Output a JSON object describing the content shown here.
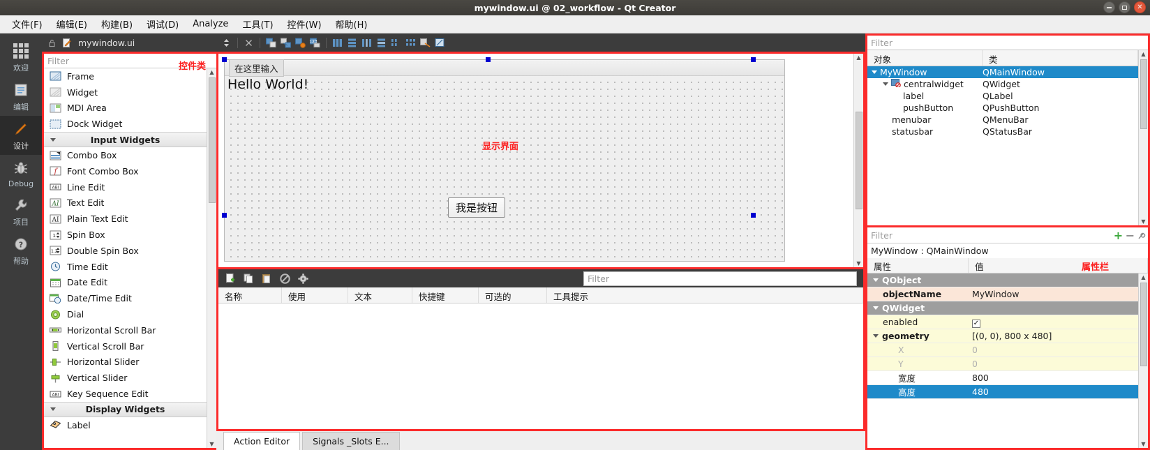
{
  "window": {
    "title": "mywindow.ui @ 02_workflow - Qt Creator",
    "controls": {
      "minimize": "minimize-icon",
      "maximize": "maximize-icon",
      "close": "close-icon"
    }
  },
  "menubar": {
    "items": [
      {
        "label": "文件(F)",
        "mnemonic": "F"
      },
      {
        "label": "编辑(E)",
        "mnemonic": "E"
      },
      {
        "label": "构建(B)",
        "mnemonic": "B"
      },
      {
        "label": "调试(D)",
        "mnemonic": "D"
      },
      {
        "label": "Analyze",
        "mnemonic": "A"
      },
      {
        "label": "工具(T)",
        "mnemonic": "T"
      },
      {
        "label": "控件(W)",
        "mnemonic": "W"
      },
      {
        "label": "帮助(H)",
        "mnemonic": "H"
      }
    ]
  },
  "modebar": {
    "items": [
      {
        "label": "欢迎",
        "icon": "grid-icon",
        "active": false
      },
      {
        "label": "编辑",
        "icon": "document-icon",
        "active": false
      },
      {
        "label": "设计",
        "icon": "pencil-icon",
        "active": true
      },
      {
        "label": "Debug",
        "icon": "bug-icon",
        "active": false
      },
      {
        "label": "项目",
        "icon": "wrench-icon",
        "active": false
      },
      {
        "label": "帮助",
        "icon": "question-icon",
        "active": false
      }
    ]
  },
  "designer_toolbar": {
    "document_name": "mywindow.ui",
    "lock_icon": "lock-icon",
    "file_icon": "file-edit-icon",
    "split_icon": "split-icon",
    "close_icon": "close-document-icon",
    "tools": [
      "edit-widgets-icon",
      "edit-signals-slots-icon",
      "edit-buddies-icon",
      "edit-tab-order-icon",
      "layout-horizontal-icon",
      "layout-vertical-icon",
      "layout-splitter-horizontal-icon",
      "layout-splitter-vertical-icon",
      "layout-form-icon",
      "layout-grid-icon",
      "break-layout-icon",
      "adjust-size-icon"
    ]
  },
  "widget_box": {
    "filter_placeholder": "Filter",
    "annotation": "控件类",
    "groups": [
      {
        "name": "",
        "items": [
          {
            "label": "Frame",
            "icon": "frame-icon"
          },
          {
            "label": "Widget",
            "icon": "widget-icon"
          },
          {
            "label": "MDI Area",
            "icon": "mdi-area-icon"
          },
          {
            "label": "Dock Widget",
            "icon": "dock-widget-icon"
          }
        ]
      },
      {
        "name": "Input Widgets",
        "items": [
          {
            "label": "Combo Box",
            "icon": "combo-box-icon"
          },
          {
            "label": "Font Combo Box",
            "icon": "font-combo-box-icon"
          },
          {
            "label": "Line Edit",
            "icon": "line-edit-icon"
          },
          {
            "label": "Text Edit",
            "icon": "text-edit-icon"
          },
          {
            "label": "Plain Text Edit",
            "icon": "plain-text-edit-icon"
          },
          {
            "label": "Spin Box",
            "icon": "spin-box-icon"
          },
          {
            "label": "Double Spin Box",
            "icon": "double-spin-box-icon"
          },
          {
            "label": "Time Edit",
            "icon": "time-edit-icon"
          },
          {
            "label": "Date Edit",
            "icon": "date-edit-icon"
          },
          {
            "label": "Date/Time Edit",
            "icon": "date-time-edit-icon"
          },
          {
            "label": "Dial",
            "icon": "dial-icon"
          },
          {
            "label": "Horizontal Scroll Bar",
            "icon": "horizontal-scroll-bar-icon"
          },
          {
            "label": "Vertical Scroll Bar",
            "icon": "vertical-scroll-bar-icon"
          },
          {
            "label": "Horizontal Slider",
            "icon": "horizontal-slider-icon"
          },
          {
            "label": "Vertical Slider",
            "icon": "vertical-slider-icon"
          },
          {
            "label": "Key Sequence Edit",
            "icon": "key-sequence-edit-icon"
          }
        ]
      },
      {
        "name": "Display Widgets",
        "items": [
          {
            "label": "Label",
            "icon": "label-icon"
          }
        ]
      }
    ]
  },
  "form_editor": {
    "menubar_placeholder": "在这里输入",
    "label_text": "Hello World!",
    "button_text": "我是按钮",
    "annotation": "显示界面"
  },
  "action_editor": {
    "filter_placeholder": "Filter",
    "toolbar": [
      "new-action-icon",
      "copy-icon",
      "paste-icon",
      "delete-icon",
      "settings-icon"
    ],
    "columns": [
      "名称",
      "使用",
      "文本",
      "快捷键",
      "可选的",
      "工具提示"
    ],
    "rows": [],
    "tabs": [
      {
        "label": "Action Editor",
        "active": true
      },
      {
        "label": "Signals _Slots E...",
        "active": false
      }
    ]
  },
  "object_inspector": {
    "filter_placeholder": "Filter",
    "columns": [
      "对象",
      "类"
    ],
    "rows": [
      {
        "object": "MyWindow",
        "class": "QMainWindow",
        "indent": 0,
        "expander": "down",
        "selected": true,
        "icon": ""
      },
      {
        "object": "centralwidget",
        "class": "QWidget",
        "indent": 1,
        "expander": "down",
        "selected": false,
        "icon": "no-layout-icon"
      },
      {
        "object": "label",
        "class": "QLabel",
        "indent": 2,
        "expander": "",
        "selected": false,
        "icon": ""
      },
      {
        "object": "pushButton",
        "class": "QPushButton",
        "indent": 2,
        "expander": "",
        "selected": false,
        "icon": ""
      },
      {
        "object": "menubar",
        "class": "QMenuBar",
        "indent": 1,
        "expander": "",
        "selected": false,
        "icon": ""
      },
      {
        "object": "statusbar",
        "class": "QStatusBar",
        "indent": 1,
        "expander": "",
        "selected": false,
        "icon": ""
      }
    ]
  },
  "property_editor": {
    "filter_placeholder": "Filter",
    "buttons": [
      "add-property-icon",
      "remove-property-icon",
      "configure-icon"
    ],
    "object_title": "MyWindow : QMainWindow",
    "annotation": "属性栏",
    "columns": [
      "属性",
      "值"
    ],
    "rows": [
      {
        "name": "QObject",
        "value": "",
        "type": "group"
      },
      {
        "name": "objectName",
        "value": "MyWindow",
        "type": "prop-bold",
        "bg": "#fbe6d8"
      },
      {
        "name": "QWidget",
        "value": "",
        "type": "group"
      },
      {
        "name": "enabled",
        "value": "",
        "type": "check",
        "checked": true,
        "bg": "#fcfbd8"
      },
      {
        "name": "geometry",
        "value": "[(0, 0), 800 x 480]",
        "type": "prop-bold",
        "expander": "down",
        "bg": "#fcfbd8"
      },
      {
        "name": "X",
        "value": "0",
        "type": "sub",
        "bg": "#fcfbd8"
      },
      {
        "name": "Y",
        "value": "0",
        "type": "sub",
        "bg": "#fcfbd8"
      },
      {
        "name": "宽度",
        "value": "800",
        "type": "sub-dark",
        "bg": "#ffffff"
      },
      {
        "name": "高度",
        "value": "480",
        "type": "selected",
        "bg": "#1f8ac9"
      }
    ]
  },
  "colors": {
    "accent_selection": "#1f8ac9",
    "annotation_red": "#fc2020",
    "highlight_border": "#fb2b2b",
    "toolbar_dark": "#3c3c3c",
    "close_button": "#e2573a"
  }
}
